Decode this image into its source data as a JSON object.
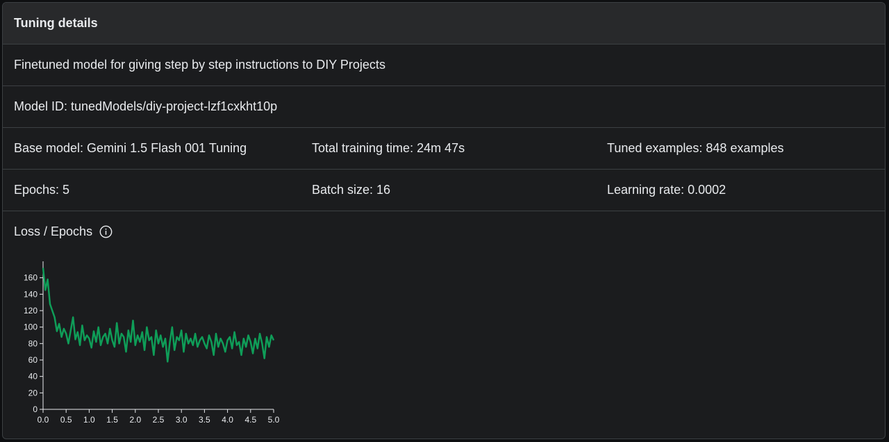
{
  "header": {
    "title": "Tuning details"
  },
  "description": "Finetuned model for giving step by step instructions to DIY Projects",
  "model_id": "Model ID: tunedModels/diy-project-lzf1cxkht10p",
  "stats_row1": {
    "base_model": "Base model: Gemini 1.5 Flash 001 Tuning",
    "training_time": "Total training time: 24m 47s",
    "tuned_examples": "Tuned examples: 848 examples"
  },
  "stats_row2": {
    "epochs": "Epochs: 5",
    "batch_size": "Batch size: 16",
    "learning_rate": "Learning rate: 0.0002"
  },
  "chart_section": {
    "title": "Loss / Epochs",
    "info_icon": "info-icon"
  },
  "chart_data": {
    "type": "line",
    "xlim": [
      0,
      5.0
    ],
    "ylim": [
      0,
      180
    ],
    "x_ticks": [
      "0.0",
      "0.5",
      "1.0",
      "1.5",
      "2.0",
      "2.5",
      "3.0",
      "3.5",
      "4.0",
      "4.5",
      "5.0"
    ],
    "y_ticks": [
      "0",
      "20",
      "40",
      "60",
      "80",
      "100",
      "120",
      "140",
      "160"
    ],
    "series_color": "#0f9d58",
    "series": [
      {
        "x": [
          0.0,
          0.05,
          0.1,
          0.15,
          0.2,
          0.25,
          0.3,
          0.35,
          0.4,
          0.45,
          0.5,
          0.55,
          0.6,
          0.65,
          0.7,
          0.75,
          0.8,
          0.85,
          0.9,
          0.95,
          1.0,
          1.05,
          1.1,
          1.15,
          1.2,
          1.25,
          1.3,
          1.35,
          1.4,
          1.45,
          1.5,
          1.55,
          1.6,
          1.65,
          1.7,
          1.75,
          1.8,
          1.85,
          1.9,
          1.95,
          2.0,
          2.05,
          2.1,
          2.15,
          2.2,
          2.25,
          2.3,
          2.35,
          2.4,
          2.45,
          2.5,
          2.55,
          2.6,
          2.65,
          2.7,
          2.75,
          2.8,
          2.85,
          2.9,
          2.95,
          3.0,
          3.05,
          3.1,
          3.15,
          3.2,
          3.25,
          3.3,
          3.35,
          3.4,
          3.45,
          3.5,
          3.55,
          3.6,
          3.65,
          3.7,
          3.75,
          3.8,
          3.85,
          3.9,
          3.95,
          4.0,
          4.05,
          4.1,
          4.15,
          4.2,
          4.25,
          4.3,
          4.35,
          4.4,
          4.45,
          4.5,
          4.55,
          4.6,
          4.65,
          4.7,
          4.75,
          4.8,
          4.85,
          4.9,
          4.95,
          5.0
        ],
        "y": [
          172,
          145,
          158,
          128,
          120,
          112,
          95,
          104,
          88,
          98,
          92,
          80,
          96,
          112,
          85,
          94,
          78,
          102,
          84,
          90,
          86,
          75,
          95,
          82,
          100,
          78,
          88,
          92,
          80,
          98,
          84,
          76,
          105,
          80,
          92,
          88,
          70,
          96,
          82,
          108,
          78,
          90,
          82,
          94,
          72,
          100,
          84,
          88,
          66,
          96,
          80,
          90,
          76,
          86,
          58,
          82,
          100,
          72,
          88,
          84,
          96,
          70,
          92,
          80,
          86,
          78,
          92,
          76,
          84,
          88,
          80,
          74,
          90,
          82,
          66,
          92,
          76,
          86,
          80,
          70,
          84,
          88,
          74,
          94,
          78,
          82,
          66,
          86,
          76,
          90,
          82,
          68,
          86,
          74,
          92,
          80,
          62,
          88,
          76,
          90,
          84
        ]
      }
    ]
  }
}
